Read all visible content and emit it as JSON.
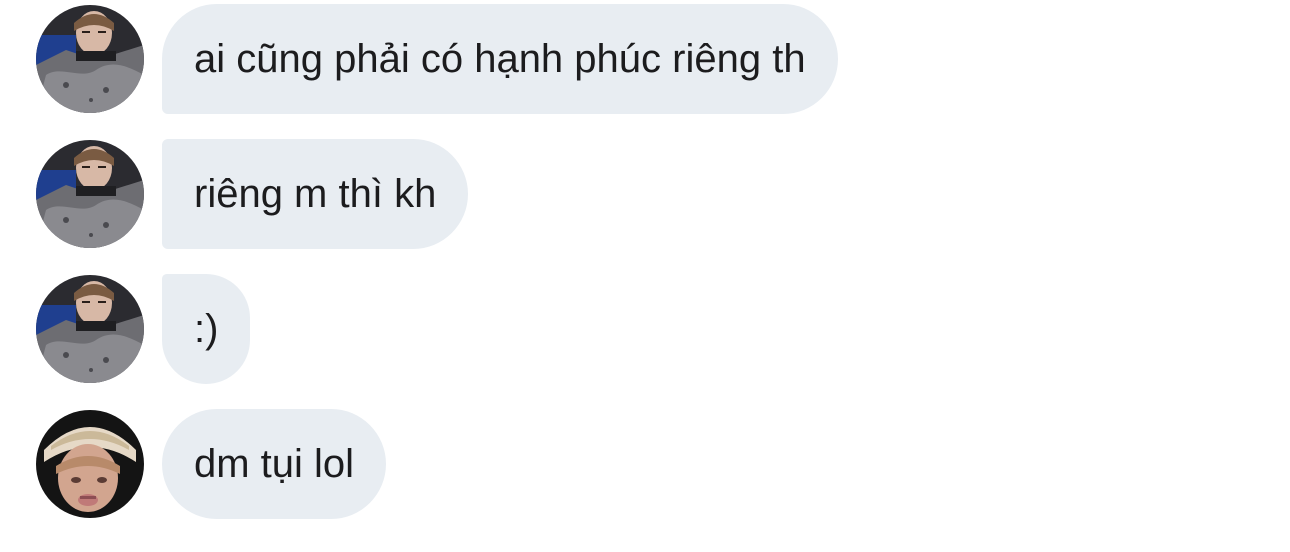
{
  "thread": {
    "messages": [
      {
        "sender": "user-a",
        "avatar_icon": "user-a-avatar-icon",
        "text": "ai cũng phải có hạnh phúc riêng th"
      },
      {
        "sender": "user-a",
        "avatar_icon": "user-a-avatar-icon",
        "text": "riêng m thì kh"
      },
      {
        "sender": "user-a",
        "avatar_icon": "user-a-avatar-icon",
        "text": ":)"
      },
      {
        "sender": "user-b",
        "avatar_icon": "user-b-avatar-icon",
        "text": "dm tụi lol"
      }
    ]
  },
  "colors": {
    "bubble_background": "#e8edf2",
    "bubble_text": "#1c1c1e",
    "page_background": "#ffffff"
  }
}
